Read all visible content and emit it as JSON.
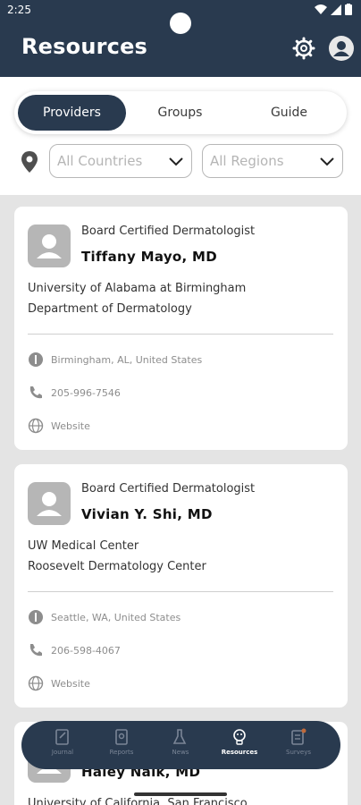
{
  "status": {
    "time": "2:25"
  },
  "header": {
    "title": "Resources"
  },
  "tabs": [
    {
      "label": "Providers",
      "active": true
    },
    {
      "label": "Groups",
      "active": false
    },
    {
      "label": "Guide",
      "active": false
    }
  ],
  "filters": {
    "country_placeholder": "All Countries",
    "region_placeholder": "All Regions"
  },
  "providers": [
    {
      "role": "Board Certified Dermatologist",
      "name": "Tiffany Mayo, MD",
      "institution_line1": "University of Alabama at Birmingham",
      "institution_line2": "Department of Dermatology",
      "location": "Birmingham, AL, United States",
      "phone": "205-996-7546",
      "website": "Website"
    },
    {
      "role": "Board Certified Dermatologist",
      "name": "Vivian Y. Shi, MD",
      "institution_line1": "UW Medical Center",
      "institution_line2": "Roosevelt Dermatology Center",
      "location": "Seattle, WA, United States",
      "phone": "206-598-4067",
      "website": "Website"
    },
    {
      "name": "Haley Naik, MD",
      "institution_line1": "University of California, San Francisco"
    }
  ],
  "nav": {
    "items": [
      {
        "label": "Journal",
        "icon": "journal-icon"
      },
      {
        "label": "Reports",
        "icon": "reports-icon"
      },
      {
        "label": "News",
        "icon": "news-icon"
      },
      {
        "label": "Resources",
        "icon": "resources-icon",
        "active": true
      },
      {
        "label": "Surveys",
        "icon": "surveys-icon"
      }
    ]
  },
  "colors": {
    "primary": "#293a4f",
    "background": "#e4e4e4",
    "card": "#ffffff"
  }
}
